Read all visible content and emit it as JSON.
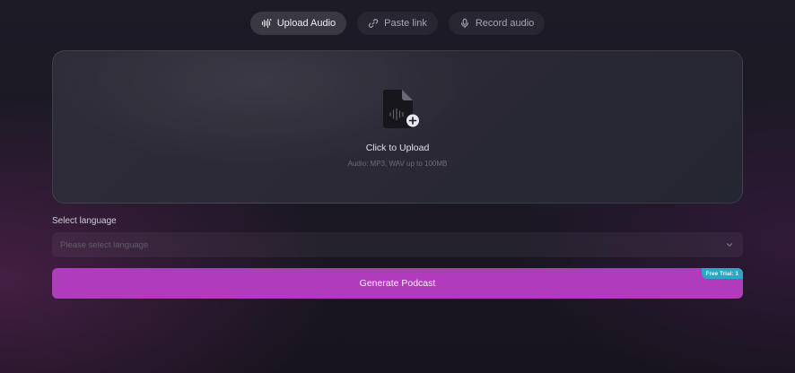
{
  "tabs": [
    {
      "label": "Upload Audio",
      "icon": "audio-wave-icon",
      "active": true
    },
    {
      "label": "Paste link",
      "icon": "link-icon",
      "active": false
    },
    {
      "label": "Record audio",
      "icon": "microphone-icon",
      "active": false
    }
  ],
  "upload": {
    "title": "Click to Upload",
    "subtitle": "Audio: MP3, WAV up to 100MB",
    "icon": "audio-file-add-icon"
  },
  "language": {
    "label": "Select language",
    "placeholder": "Please select language",
    "icon": "chevron-down-icon"
  },
  "generate": {
    "label": "Generate Podcast",
    "badge": "Free Trial: 1"
  },
  "colors": {
    "accent": "#b03bbd",
    "badge": "#2aa8c0"
  }
}
